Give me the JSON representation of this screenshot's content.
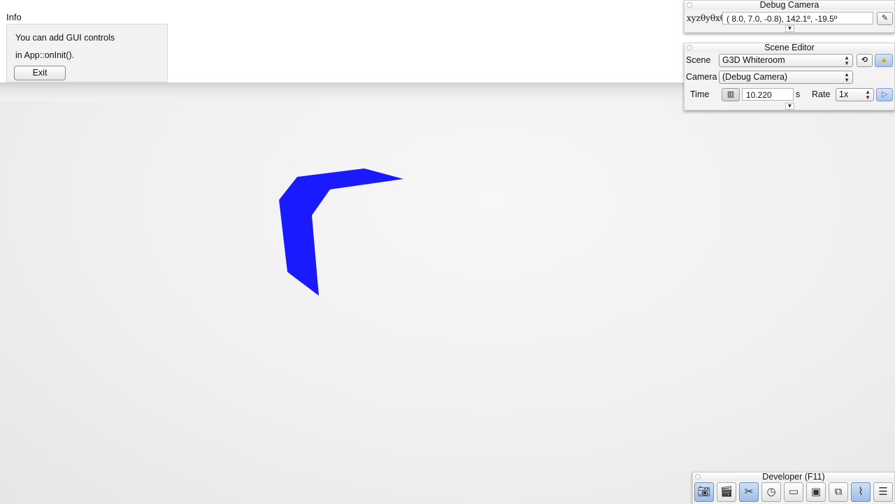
{
  "info": {
    "title": "Info",
    "line1": "You can add GUI controls",
    "line2": "in App::onInit().",
    "exit_label": "Exit"
  },
  "debug_camera": {
    "title": "Debug Camera",
    "label": "xyzθyθxθz",
    "value": "(  8.0,   7.0,  -0.8),  142.1º, -19.5º",
    "edit_icon": "pencil-icon"
  },
  "scene_editor": {
    "title": "Scene Editor",
    "scene_label": "Scene",
    "scene_value": "G3D Whiteroom",
    "camera_label": "Camera",
    "camera_value": "(Debug Camera)",
    "time_label": "Time",
    "time_value": "10.220",
    "time_unit": "s",
    "rate_label": "Rate",
    "rate_value": "1x",
    "reload_icon": "reload-icon",
    "lock_icon": "lock-icon",
    "play_icon": "play-icon"
  },
  "developer": {
    "title": "Developer (F11)",
    "tools": [
      "camera-icon",
      "film-clapper-icon",
      "tools-icon",
      "clock-icon",
      "note-icon",
      "console-icon",
      "scene-tree-icon",
      "profiler-icon",
      "log-icon"
    ]
  },
  "colors": {
    "shape": "#1a1aff",
    "active_button": "#9dbde6"
  }
}
